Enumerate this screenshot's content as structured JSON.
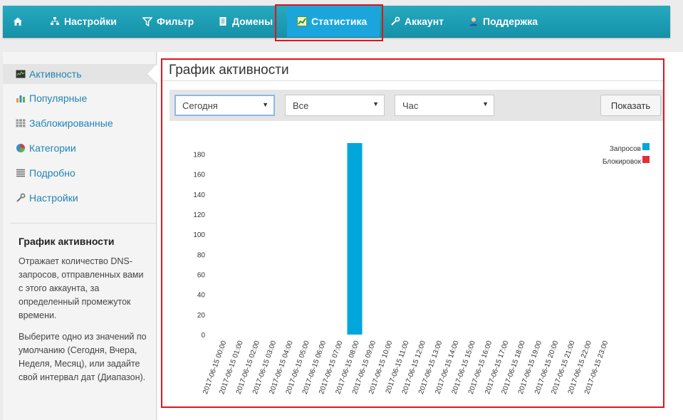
{
  "nav": {
    "items": [
      {
        "label": "",
        "icon": "home-icon"
      },
      {
        "label": "Настройки",
        "icon": "sitemap-icon"
      },
      {
        "label": "Фильтр",
        "icon": "filter-icon"
      },
      {
        "label": "Домены",
        "icon": "document-icon"
      },
      {
        "label": "Статистика",
        "icon": "chart-icon",
        "active": true
      },
      {
        "label": "Аккаунт",
        "icon": "wrench-icon"
      },
      {
        "label": "Поддержка",
        "icon": "user-icon"
      }
    ]
  },
  "sidebar": {
    "items": [
      {
        "label": "Активность",
        "icon": "activity-icon",
        "active": true
      },
      {
        "label": "Популярные",
        "icon": "bar-chart-icon"
      },
      {
        "label": "Заблокированные",
        "icon": "blocked-grid-icon"
      },
      {
        "label": "Категории",
        "icon": "pie-chart-icon"
      },
      {
        "label": "Подробно",
        "icon": "list-icon"
      },
      {
        "label": "Настройки",
        "icon": "wrench-icon"
      }
    ],
    "help_title": "График активности",
    "help_p1": "Отражает количество DNS-запросов, отправленных вами с этого аккаунта, за определенный промежуток времени.",
    "help_p2": "Выберите одно из значений по умолчанию (Сегодня, Вчера, Неделя, Месяц), или задайте свой интервал дат (Диапазон)."
  },
  "main": {
    "title": "График активности",
    "filters": {
      "period": "Сегодня",
      "scope": "Все",
      "granularity": "Час"
    },
    "show_button": "Показать"
  },
  "colors": {
    "nav": "#1b9db4",
    "requests": "#00a6dc",
    "blocked": "#e0303a",
    "highlight": "#e0141a"
  },
  "chart_data": {
    "type": "bar",
    "categories": [
      "2017-06-15 00:00",
      "2017-06-15 01:00",
      "2017-06-15 02:00",
      "2017-06-15 03:00",
      "2017-06-15 04:00",
      "2017-06-15 05:00",
      "2017-06-15 06:00",
      "2017-06-15 07:00",
      "2017-06-15 08:00",
      "2017-06-15 09:00",
      "2017-06-15 10:00",
      "2017-06-15 11:00",
      "2017-06-15 12:00",
      "2017-06-15 13:00",
      "2017-06-15 14:00",
      "2017-06-15 15:00",
      "2017-06-15 16:00",
      "2017-06-15 17:00",
      "2017-06-15 18:00",
      "2017-06-15 19:00",
      "2017-06-15 20:00",
      "2017-06-15 21:00",
      "2017-06-15 22:00",
      "2017-06-15 23:00"
    ],
    "series": [
      {
        "name": "Запросов",
        "color": "#00a6dc",
        "values": [
          0,
          0,
          0,
          0,
          0,
          0,
          0,
          0,
          191,
          0,
          0,
          0,
          0,
          0,
          0,
          0,
          0,
          0,
          0,
          0,
          0,
          0,
          0,
          0
        ]
      },
      {
        "name": "Блокировок",
        "color": "#e0303a",
        "values": [
          0,
          0,
          0,
          0,
          0,
          0,
          0,
          0,
          0,
          0,
          0,
          0,
          0,
          0,
          0,
          0,
          0,
          0,
          0,
          0,
          0,
          0,
          0,
          0
        ]
      }
    ],
    "yticks": [
      0,
      20,
      40,
      60,
      80,
      100,
      120,
      140,
      160,
      180
    ],
    "ylim": [
      0,
      191
    ],
    "grid": false,
    "legend": "top-right"
  }
}
